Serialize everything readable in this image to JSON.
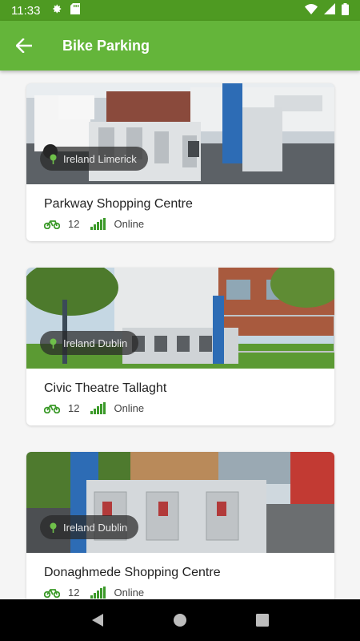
{
  "status_bar": {
    "time": "11:33"
  },
  "app_bar": {
    "title": "Bike Parking"
  },
  "cards": [
    {
      "location": "Ireland Limerick",
      "title": "Parkway Shopping Centre",
      "bikes": "12",
      "status": "Online"
    },
    {
      "location": "Ireland Dublin",
      "title": "Civic Theatre Tallaght",
      "bikes": "12",
      "status": "Online"
    },
    {
      "location": "Ireland Dublin",
      "title": "Donaghmede Shopping Centre",
      "bikes": "12",
      "status": "Online"
    }
  ],
  "colors": {
    "status_bar": "#4e9a22",
    "app_bar": "#64b53a",
    "accent_green": "#3c9a2a"
  }
}
